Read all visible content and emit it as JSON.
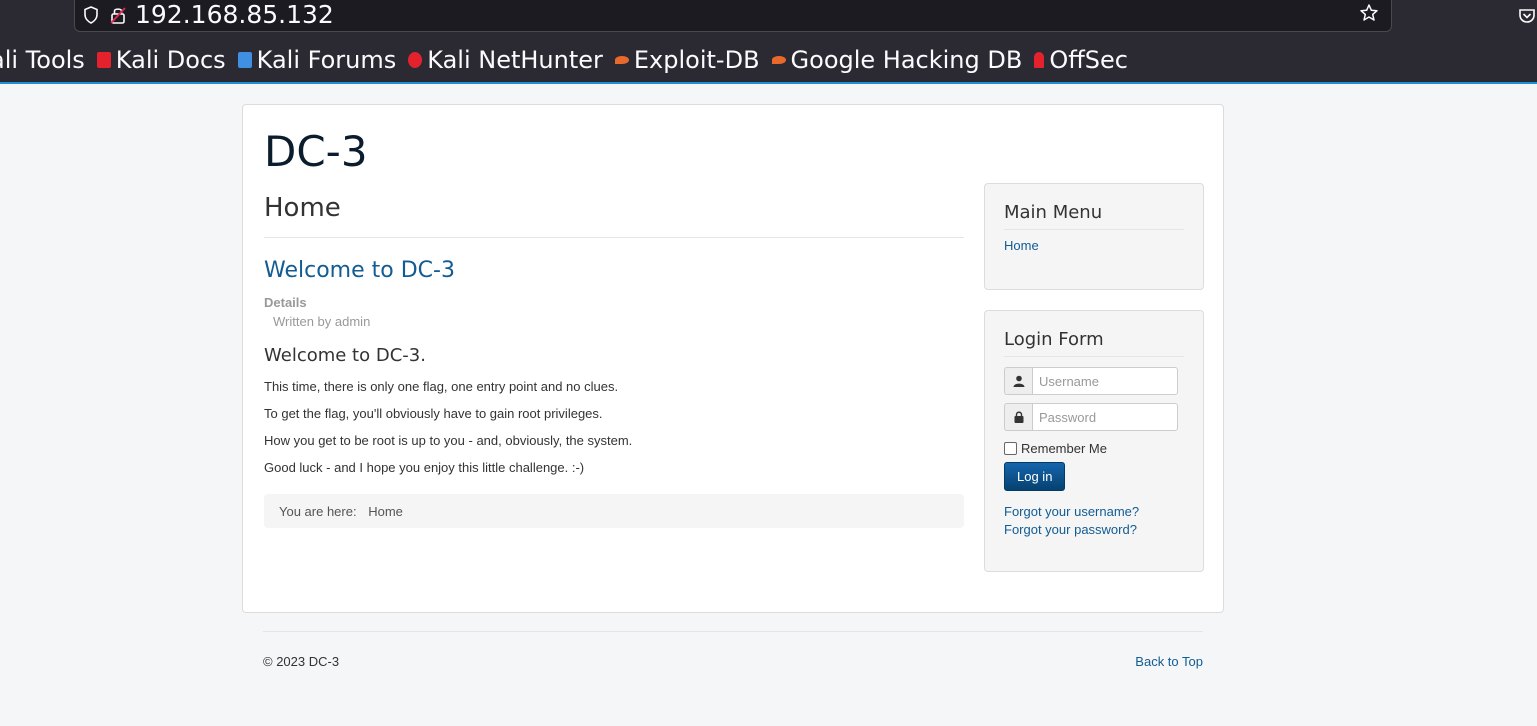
{
  "browser": {
    "url": "192.168.85.132",
    "bookmarks": [
      {
        "label": "ali Tools",
        "icon": "kali-tools-icon",
        "color": "#ffffff"
      },
      {
        "label": "Kali Docs",
        "icon": "kali-docs-icon",
        "color": "#e3222e"
      },
      {
        "label": "Kali Forums",
        "icon": "kali-forums-icon",
        "color": "#3f8fe3"
      },
      {
        "label": "Kali NetHunter",
        "icon": "kali-nethunter-icon",
        "color": "#e3222e"
      },
      {
        "label": "Exploit-DB",
        "icon": "exploit-db-icon",
        "color": "#e8692c"
      },
      {
        "label": "Google Hacking DB",
        "icon": "ghdb-icon",
        "color": "#e8692c"
      },
      {
        "label": "OffSec",
        "icon": "offsec-icon",
        "color": "#e3222e"
      }
    ]
  },
  "site": {
    "brand": "DC-3"
  },
  "main": {
    "page_header": "Home",
    "article": {
      "title": "Welcome to DC-3",
      "details_label": "Details",
      "author": "Written by admin",
      "heading": "Welcome to DC-3.",
      "paragraphs": [
        "This time, there is only one flag, one entry point and no clues.",
        "To get the flag, you'll obviously have to gain root privileges.",
        "How you get to be root is up to you - and, obviously, the system.",
        "Good luck - and I hope you enjoy this little challenge.  :-)"
      ]
    },
    "breadcrumb": {
      "prefix": "You are here:",
      "current": "Home"
    }
  },
  "sidebar": {
    "main_menu": {
      "title": "Main Menu",
      "items": [
        {
          "label": "Home"
        }
      ]
    },
    "login": {
      "title": "Login Form",
      "username_placeholder": "Username",
      "password_placeholder": "Password",
      "remember_label": "Remember Me",
      "remember_checked": false,
      "submit_label": "Log in",
      "forgot_username": "Forgot your username?",
      "forgot_password": "Forgot your password?"
    }
  },
  "footer": {
    "copyright": "© 2023 DC-3",
    "back_to_top": "Back to Top"
  },
  "colors": {
    "link": "#125c93",
    "chrome_bg": "#2b2a33",
    "accent_line": "#1f8fd6",
    "button": "#0b4f8f"
  }
}
